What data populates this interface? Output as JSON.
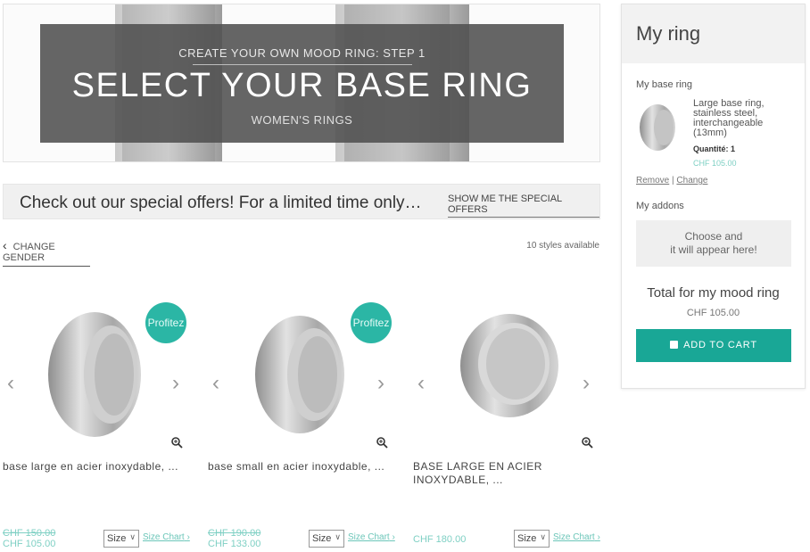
{
  "hero": {
    "step": "CREATE YOUR OWN MOOD RING: STEP 1",
    "title": "SELECT YOUR BASE RING",
    "subtitle": "WOMEN'S RINGS"
  },
  "offers": {
    "text": "Check out our special offers! For a limited time only…",
    "link": "SHOW ME THE SPECIAL OFFERS"
  },
  "gender": {
    "label": "CHANGE GENDER",
    "icon": "chevron-left-icon"
  },
  "styles_available": "10 styles available",
  "products": [
    {
      "name": "base large en acier inoxydable, ...",
      "badge": "Profitez",
      "old_price": "CHF 150.00",
      "price": "CHF 105.00",
      "size_label": "Size",
      "size_chart": "Size Chart"
    },
    {
      "name": "base small en acier inoxydable, ...",
      "badge": "Profitez",
      "old_price": "CHF 190.00",
      "price": "CHF 133.00",
      "size_label": "Size",
      "size_chart": "Size Chart"
    },
    {
      "name": "BASE LARGE EN ACIER INOXYDABLE, ...",
      "price": "CHF 180.00",
      "size_label": "Size",
      "size_chart": "Size Chart"
    }
  ],
  "sidebar": {
    "title": "My ring",
    "base_label": "My base ring",
    "base_name": "Large base ring, stainless steel, interchangeable (13mm)",
    "quantity": "Quantité: 1",
    "base_price": "CHF 105.00",
    "remove": "Remove",
    "separator": "|",
    "change": "Change",
    "addons_label": "My addons",
    "addons_line1": "Choose and",
    "addons_line2": "it will appear here!",
    "total_label": "Total for my mood ring",
    "total_value": "CHF 105.00",
    "cart_button": "ADD TO CART"
  },
  "colors": {
    "accent": "#19a796",
    "badge": "#2bb6a5",
    "price": "#7fd0c4"
  }
}
